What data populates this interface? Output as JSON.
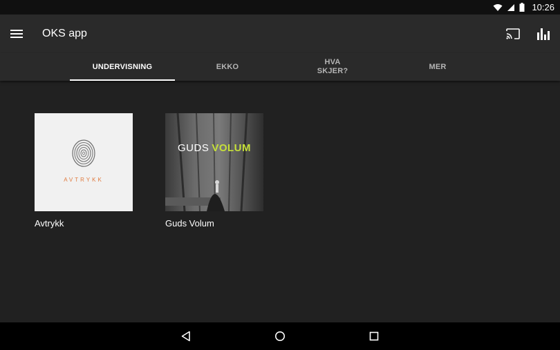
{
  "status_bar": {
    "time": "10:26",
    "icons": [
      "wifi-icon",
      "signal-icon",
      "battery-icon"
    ]
  },
  "app_bar": {
    "title": "OKS app",
    "icons": [
      "menu-icon",
      "cast-icon",
      "equalizer-icon"
    ]
  },
  "tabs": [
    {
      "label": "UNDERVISNING",
      "active": true
    },
    {
      "label": "EKKO",
      "active": false
    },
    {
      "label": "HVA SKJER?",
      "active": false
    },
    {
      "label": "MER",
      "active": false
    }
  ],
  "albums": [
    {
      "caption": "Avtrykk",
      "cover_text": "AVTRYKK",
      "cover_bg": "#f1f1f1",
      "cover_accent": "#e07a3e"
    },
    {
      "caption": "Guds Volum",
      "cover_text": [
        "GUDS",
        "VOLUM"
      ],
      "cover_accent": "#c6e03a"
    }
  ],
  "nav_bar": {
    "icons": [
      "back-icon",
      "home-icon",
      "recents-icon"
    ]
  },
  "colors": {
    "background": "#212121",
    "app_bar": "#2a2a2a",
    "status_bar": "#101010",
    "nav_bar": "#000000"
  }
}
